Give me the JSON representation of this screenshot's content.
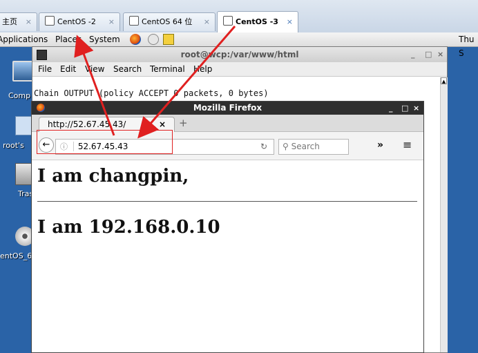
{
  "vm_tabs": {
    "home_label": "主页",
    "tab1": "CentOS -2",
    "tab2": "CentOS 64 位",
    "tab3": "CentOS -3",
    "close": "×"
  },
  "gnome_panel": {
    "applications": "Applications",
    "places": "Places",
    "system": "System",
    "clock": "Thu S"
  },
  "desktop": {
    "computer": "Comp",
    "home": "root's",
    "trash": "Tras",
    "dvd": "entOS_6"
  },
  "terminal": {
    "title": "root@wcp:/var/www/html",
    "menu": [
      "File",
      "Edit",
      "View",
      "Search",
      "Terminal",
      "Help"
    ],
    "line1": "Chain OUTPUT (policy ACCEPT 0 packets, 0 bytes)"
  },
  "firefox": {
    "title": "Mozilla Firefox",
    "tab_title": "http://52.67.45.43/",
    "url": "52.67.45.43",
    "search_placeholder": "Search",
    "heading1": "I am changpin,",
    "heading2": "I am 192.168.0.10"
  },
  "colors": {
    "annotation_red": "#e02020",
    "desktop_blue": "#2a63a7"
  }
}
